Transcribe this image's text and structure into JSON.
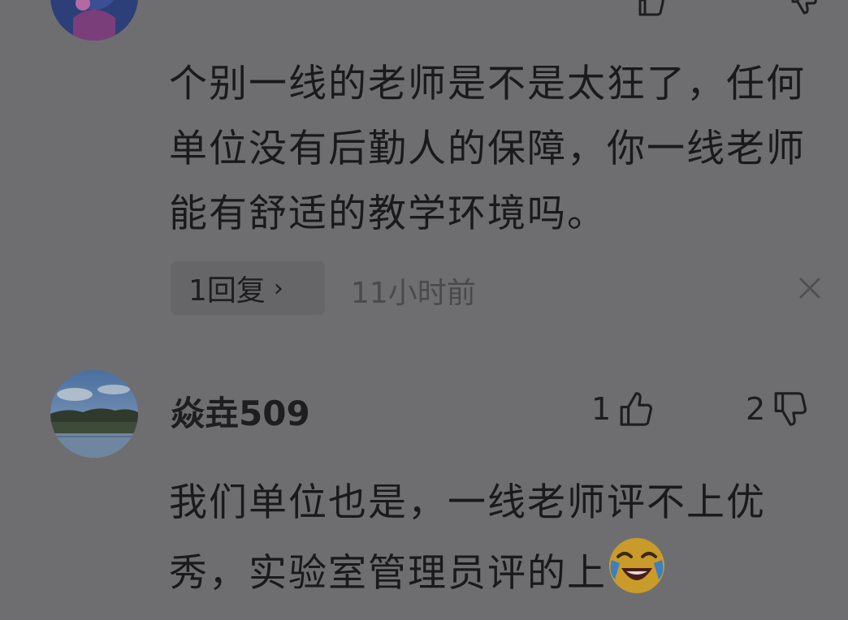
{
  "comment_prev": {
    "text": "个别一线的老师是不是太狂了，任何单位没有后勤人的保障，你一线老师能有舒适的教学环境吗。",
    "reply_chip": {
      "count_label": "1回复",
      "chevron": "›"
    },
    "time": "11小时前",
    "icons": {
      "avatar": "avatar-icon",
      "thumbs_up": "thumbs-up-icon",
      "thumbs_down": "thumbs-down-icon",
      "close": "close-icon"
    }
  },
  "comment_main": {
    "username": "焱垚509",
    "likes": "1",
    "dislikes": "2",
    "text": "我们单位也是，一线老师评不上优秀，实验室管理员评的上",
    "emoji": "laughing-crying-emoji",
    "icons": {
      "avatar": "landscape-avatar",
      "thumbs_up": "thumbs-up-icon",
      "thumbs_down": "thumbs-down-icon"
    }
  },
  "colors": {
    "background": "#6e6e70",
    "text": "#1a1a1c",
    "muted": "#4a4a4c"
  }
}
